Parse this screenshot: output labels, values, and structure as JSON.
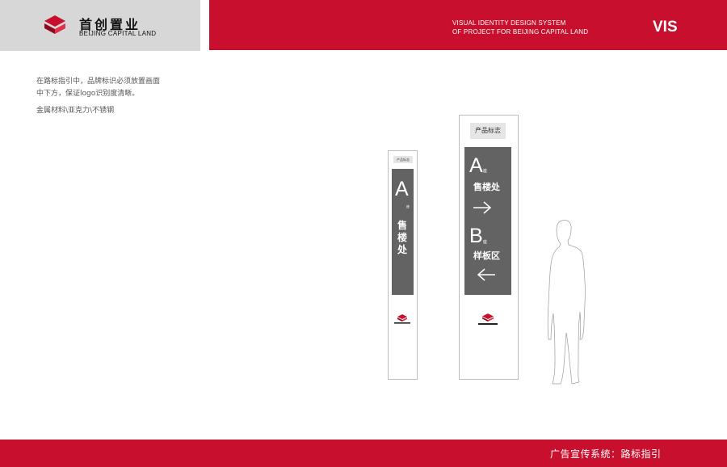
{
  "brand": {
    "name_cn": "首创置业",
    "name_en": "BEIJING CAPITAL LAND"
  },
  "header": {
    "line1": "VISUAL IDENTITY DESIGN SYSTEM",
    "line2": "OF PROJECT FOR BEIJING CAPITAL LAND",
    "badge": "VIS"
  },
  "description": {
    "line1": "在路标指引中，品牌标识必须放置画面",
    "line2": "中下方，保证logo识别度清晰。",
    "line3": "金属材料\\亚克力\\不锈钢"
  },
  "sign_small": {
    "tag": "产品标志",
    "letter": "A",
    "suffix": "座",
    "text": "售楼处"
  },
  "sign_large": {
    "tag": "产品标志",
    "a_letter": "A",
    "a_suffix": "座",
    "a_text": "售楼处",
    "b_letter": "B",
    "b_suffix": "座",
    "b_text": "样板区"
  },
  "footer": {
    "title": "广告宣传系统：路标指引"
  },
  "colors": {
    "brand_red": "#c8102e",
    "panel_gray": "#636363",
    "header_gray": "#d7d7d7"
  }
}
